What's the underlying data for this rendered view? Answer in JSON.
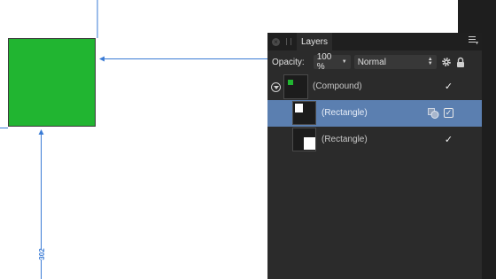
{
  "canvas": {
    "shape_color": "#21b531",
    "guide_color": "#3a7bd5",
    "measure_value": "302"
  },
  "layers_panel": {
    "tab_label": "Layers",
    "opacity_label": "Opacity:",
    "opacity_value": "100 %",
    "blend_mode": "Normal",
    "icons": [
      "close-icon",
      "menu-icon",
      "gear-icon",
      "lock-icon"
    ],
    "layers": [
      {
        "name": "(Compound)",
        "visible": true,
        "selected": false,
        "expanded": true
      },
      {
        "name": "(Rectangle)",
        "visible": true,
        "selected": true
      },
      {
        "name": "(Rectangle)",
        "visible": true,
        "selected": false
      }
    ],
    "selection_color": "#5b7fb0"
  }
}
